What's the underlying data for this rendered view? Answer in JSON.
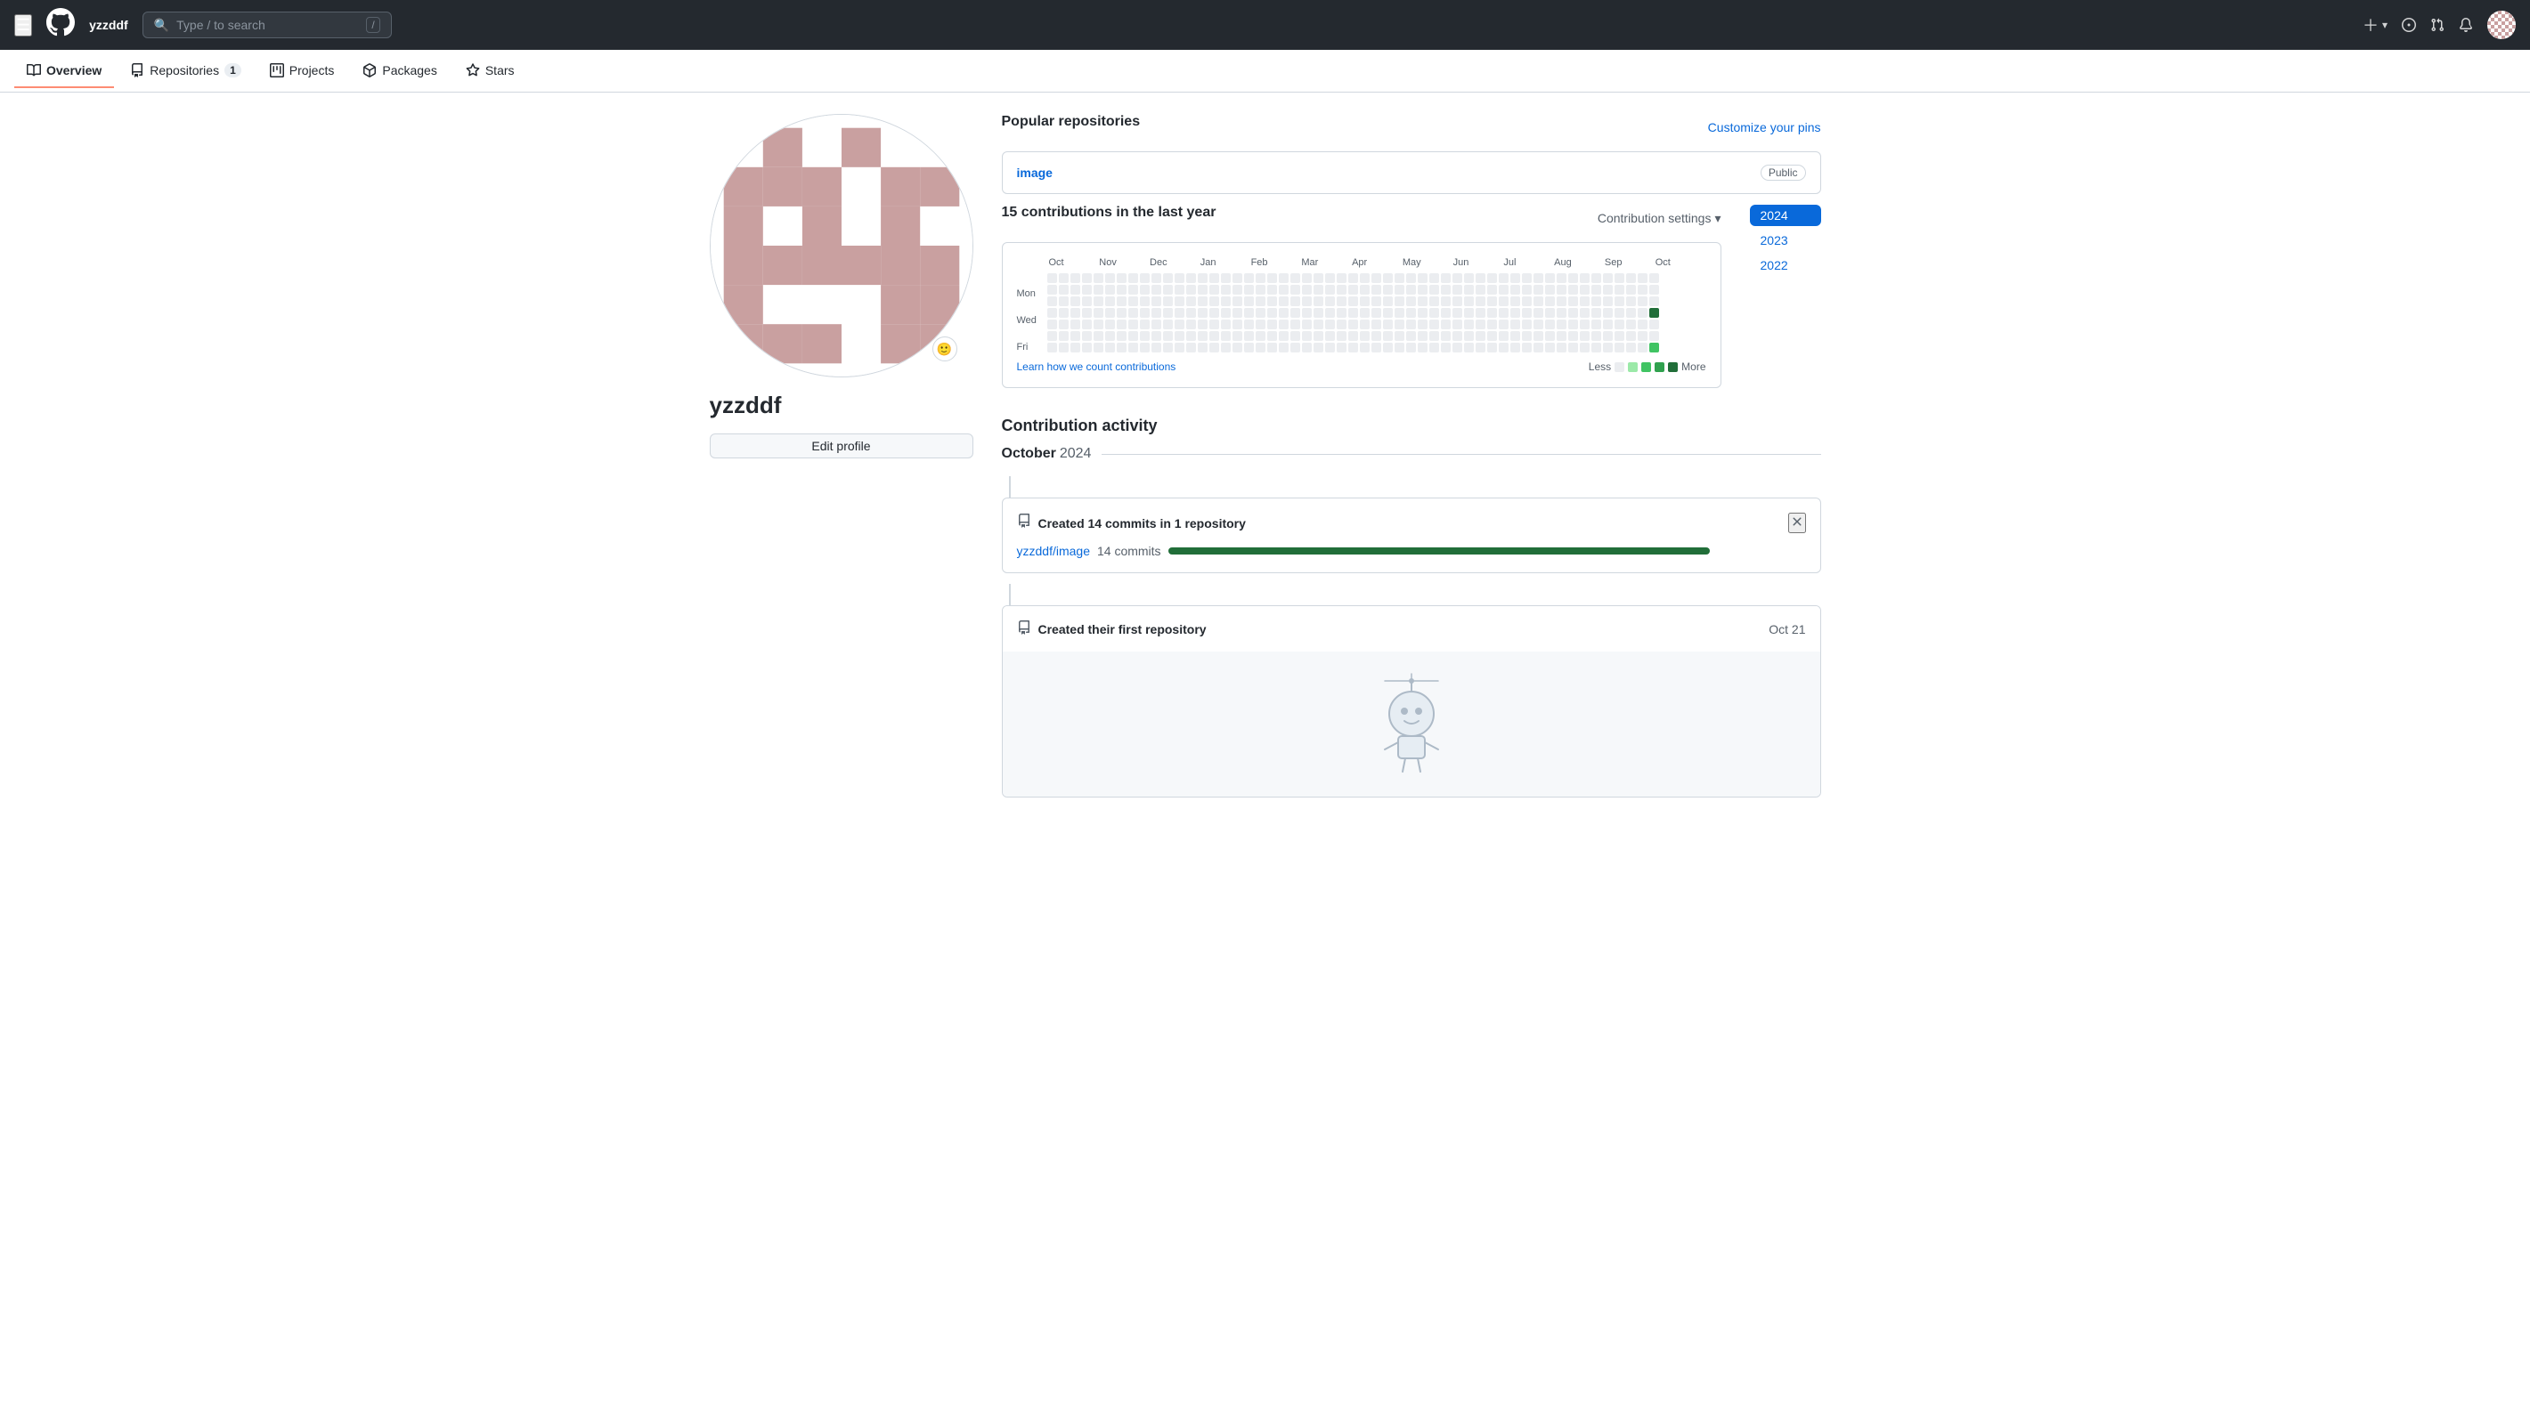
{
  "topNav": {
    "username": "yzzddf",
    "searchPlaceholder": "Type / to search",
    "searchShortcut": "/",
    "addLabel": "+",
    "issuesTitle": "Issues",
    "pullRequestsTitle": "Pull Requests",
    "notificationsTitle": "Notifications"
  },
  "subNav": {
    "items": [
      {
        "id": "overview",
        "label": "Overview",
        "active": true,
        "badge": null,
        "icon": "book"
      },
      {
        "id": "repositories",
        "label": "Repositories",
        "active": false,
        "badge": "1",
        "icon": "repo"
      },
      {
        "id": "projects",
        "label": "Projects",
        "active": false,
        "badge": null,
        "icon": "table"
      },
      {
        "id": "packages",
        "label": "Packages",
        "active": false,
        "badge": null,
        "icon": "package"
      },
      {
        "id": "stars",
        "label": "Stars",
        "active": false,
        "badge": null,
        "icon": "star"
      }
    ]
  },
  "profile": {
    "username": "yzzddf",
    "editProfileLabel": "Edit profile"
  },
  "popularRepos": {
    "title": "Popular repositories",
    "customizeLabel": "Customize your pins",
    "repos": [
      {
        "name": "image",
        "visibility": "Public"
      }
    ]
  },
  "contributions": {
    "title": "15 contributions in the last year",
    "settingsLabel": "Contribution settings",
    "months": [
      "Oct",
      "Nov",
      "Dec",
      "Jan",
      "Feb",
      "Mar",
      "Apr",
      "May",
      "Jun",
      "Jul",
      "Aug",
      "Sep",
      "Oct"
    ],
    "days": [
      "Mon",
      "",
      "Wed",
      "",
      "Fri"
    ],
    "legend": {
      "lessLabel": "Less",
      "moreLabel": "More"
    },
    "years": [
      {
        "year": "2024",
        "active": true
      },
      {
        "year": "2023",
        "active": false
      },
      {
        "year": "2022",
        "active": false
      }
    ]
  },
  "activity": {
    "title": "Contribution activity",
    "monthHeader": "October",
    "yearHeader": "2024",
    "items": [
      {
        "type": "commits",
        "description": "Created 14 commits in 1 repository",
        "repoLink": "yzzddf/image",
        "commitCount": "14 commits",
        "barWidth": "85"
      },
      {
        "type": "repo",
        "description": "Created their first repository",
        "date": "Oct 21"
      }
    ]
  }
}
